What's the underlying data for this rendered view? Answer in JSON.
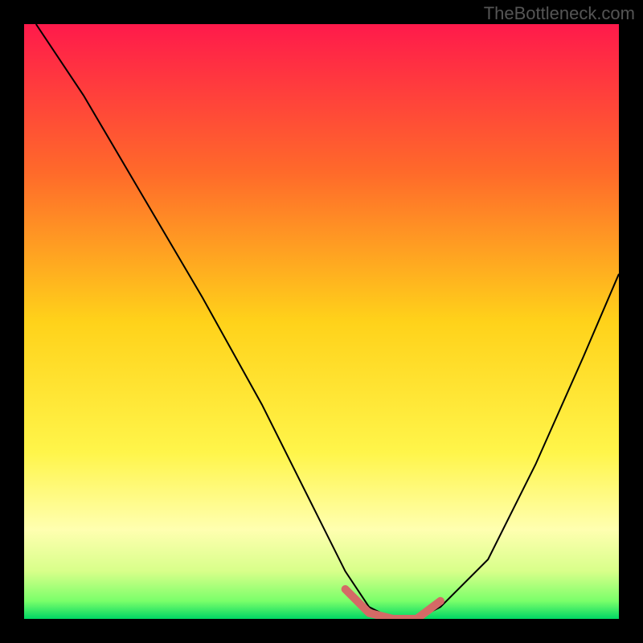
{
  "watermark": "TheBottleneck.com",
  "chart_data": {
    "type": "line",
    "title": "",
    "xlabel": "",
    "ylabel": "",
    "xlim": [
      0,
      100
    ],
    "ylim": [
      0,
      100
    ],
    "series": [
      {
        "name": "curve",
        "x": [
          2,
          10,
          20,
          30,
          40,
          48,
          54,
          58,
          62,
          66,
          70,
          78,
          86,
          94,
          100
        ],
        "values": [
          100,
          88,
          71,
          54,
          36,
          20,
          8,
          2,
          0,
          0,
          2,
          10,
          26,
          44,
          58
        ]
      }
    ],
    "highlight": {
      "name": "bottom-marker",
      "x": [
        54,
        58,
        62,
        66,
        70
      ],
      "values": [
        5,
        1,
        0,
        0,
        3
      ],
      "color": "#d46a66"
    },
    "gradient_stops": [
      {
        "offset": 0.0,
        "color": "#ff1a4b"
      },
      {
        "offset": 0.25,
        "color": "#ff6a2a"
      },
      {
        "offset": 0.5,
        "color": "#ffd21a"
      },
      {
        "offset": 0.72,
        "color": "#fff54a"
      },
      {
        "offset": 0.85,
        "color": "#ffffb0"
      },
      {
        "offset": 0.92,
        "color": "#d8ff8a"
      },
      {
        "offset": 0.97,
        "color": "#7aff6a"
      },
      {
        "offset": 1.0,
        "color": "#00d764"
      }
    ]
  }
}
